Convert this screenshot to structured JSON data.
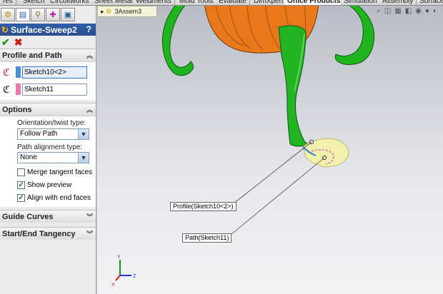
{
  "tabs": [
    {
      "label": "res",
      "active": false
    },
    {
      "label": "Sketch",
      "active": false
    },
    {
      "label": "Circuitworks",
      "active": false
    },
    {
      "label": "Sheet Metal",
      "active": false
    },
    {
      "label": "Weldments",
      "active": false
    },
    {
      "label": "Mold Tools",
      "active": false
    },
    {
      "label": "Evaluate",
      "active": false
    },
    {
      "label": "DimXpert",
      "active": false
    },
    {
      "label": "Office Products",
      "active": true
    },
    {
      "label": "Simulation",
      "active": false
    },
    {
      "label": "Assembly",
      "active": false
    },
    {
      "label": "Surfaces",
      "active": false
    }
  ],
  "panel_tabs": [
    "feature-manager",
    "property-manager",
    "configuration-manager",
    "dimxpert-manager",
    "display-manager"
  ],
  "property_manager": {
    "title": "Surface-Sweep2",
    "help": "?",
    "ok": "✔",
    "cancel": "✖",
    "profile_and_path": {
      "heading": "Profile and Path",
      "profile_value": "Sketch10<2>",
      "profile_color": "#4a90d9",
      "path_value": "Sketch11",
      "path_color": "#e87ab0"
    },
    "options": {
      "heading": "Options",
      "orientation_label": "Orientation/twist type:",
      "orientation_value": "Follow Path",
      "alignment_label": "Path alignment type:",
      "alignment_value": "None",
      "merge_tangent_label": "Merge tangent faces",
      "merge_tangent_checked": false,
      "show_preview_label": "Show preview",
      "show_preview_checked": true,
      "align_end_label": "Align with end faces",
      "align_end_checked": true
    },
    "guide_curves": {
      "heading": "Guide Curves"
    },
    "start_end": {
      "heading": "Start/End Tangency"
    }
  },
  "viewport": {
    "tree_item": "3Assem3",
    "callout_profile": "Profile(Sketch10<2>)",
    "callout_path": "Path(Sketch11)",
    "triad": {
      "x": "X",
      "y": "Y",
      "z": "Z"
    }
  },
  "colors": {
    "body_green": "#1fb51f",
    "body_orange": "#e8781a",
    "preview_yellow": "#f4f2a8",
    "title_blue": "#2f5ea8"
  }
}
